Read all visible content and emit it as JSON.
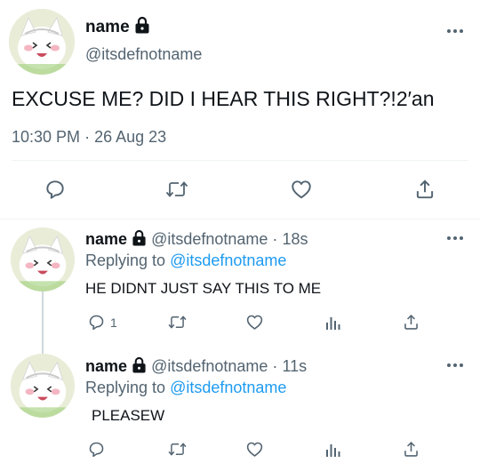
{
  "main_tweet": {
    "name": "name",
    "handle": "@itsdefnotname",
    "text": "EXCUSE ME? DID I HEAR THIS RIGHT?!2′an",
    "time": "10:30 PM",
    "separator": "·",
    "date": "26 Aug 23",
    "actions": [
      "reply-icon",
      "retweet-icon",
      "like-icon",
      "share-icon"
    ]
  },
  "replies": [
    {
      "name": "name",
      "handle": "@itsdefnotname",
      "separator": "·",
      "age": "18s",
      "replying_prefix": "Replying to",
      "replying_to": "@itsdefnotname",
      "text": "HE DIDNT JUST SAY THIS TO ME",
      "reply_count": "1"
    },
    {
      "name": "name",
      "handle": "@itsdefnotname",
      "separator": "·",
      "age": "11s",
      "replying_prefix": "Replying to",
      "replying_to": "@itsdefnotname",
      "text": "PLEASEW",
      "reply_count": ""
    }
  ],
  "colors": {
    "text": "#0f1419",
    "secondary": "#536471",
    "link": "#1d9bf0",
    "divider": "#eff3f4"
  }
}
